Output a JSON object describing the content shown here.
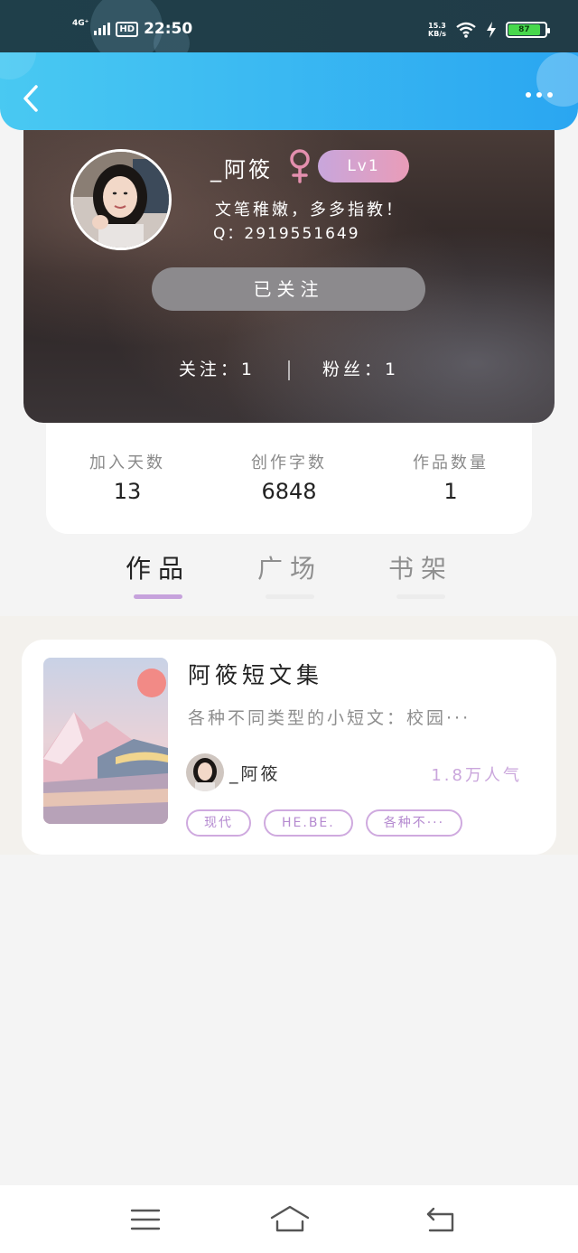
{
  "status_bar": {
    "network": "4G⁺",
    "hd_label": "HD",
    "time": "22:50",
    "speed_value": "15.3",
    "speed_unit": "KB/s",
    "battery": "87",
    "battery_color": "#48d84d"
  },
  "header": {
    "back_icon": "chevron-left-icon",
    "more_icon": "more-dots-icon",
    "gradient": [
      "#49c9f2",
      "#2aa6f1"
    ]
  },
  "profile": {
    "username": "_阿筱",
    "gender_icon": "female-icon",
    "level": "Lv1",
    "bio": "文笔稚嫩，多多指教！",
    "qq": "Q：2919551649",
    "follow_button": "已关注",
    "following": "关注：1",
    "fans": "粉丝：1"
  },
  "stats": [
    {
      "label": "加入天数",
      "value": "13"
    },
    {
      "label": "创作字数",
      "value": "6848"
    },
    {
      "label": "作品数量",
      "value": "1"
    }
  ],
  "tabs": [
    {
      "label": "作品",
      "active": true
    },
    {
      "label": "广场",
      "active": false
    },
    {
      "label": "书架",
      "active": false
    }
  ],
  "works": [
    {
      "title": "阿筱短文集",
      "description": "各种不同类型的小短文：校园···",
      "author": "_阿筱",
      "popularity": "1.8万人气",
      "tags": [
        "现代",
        "HE.BE.",
        "各种不···"
      ]
    }
  ],
  "nav": {
    "menu_icon": "menu-icon",
    "home_icon": "home-icon",
    "back_icon": "return-icon"
  },
  "colors": {
    "accent": "#c6a2dc",
    "level_gradient": [
      "#c8a6dc",
      "#e99cb8"
    ],
    "follow_button": "#8c8a8d"
  }
}
